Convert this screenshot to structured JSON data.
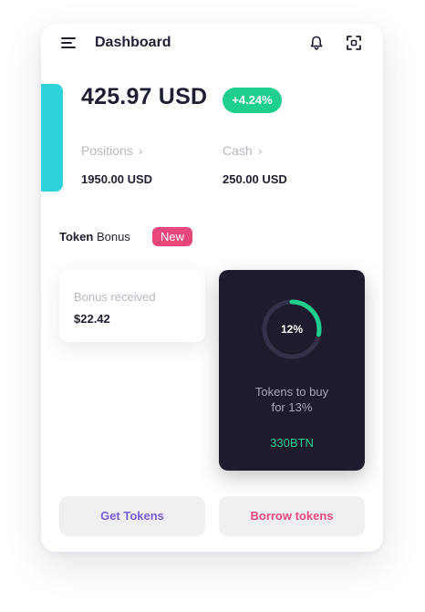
{
  "header": {
    "title": "Dashboard"
  },
  "balance": {
    "amount": "425.97 USD",
    "change": "+4.24%"
  },
  "stats": [
    {
      "label": "Positions",
      "value": "1950.00 USD"
    },
    {
      "label": "Cash",
      "value": "250.00 USD"
    }
  ],
  "token_bonus": {
    "title_bold": "Token",
    "title_rest": " Bonus",
    "badge": "New",
    "bonus_label": "Bonus received",
    "bonus_value": "$22.42",
    "progress_label": "12%",
    "progress_fraction": 0.28,
    "buy_text_line1": "Tokens to buy",
    "buy_text_line2": "for 13%",
    "buy_amount": "330BTN"
  },
  "actions": {
    "get_tokens": "Get Tokens",
    "borrow_tokens": "Borrow tokens"
  },
  "colors": {
    "accent_cyan": "#2dd3d9",
    "green": "#1fcf8e",
    "pink": "#e8477a",
    "purple": "#7b5ce0",
    "dark_card": "#1e1b2e"
  },
  "icons": [
    "menu-icon",
    "bell-icon",
    "scan-icon",
    "chevron-right-icon"
  ]
}
